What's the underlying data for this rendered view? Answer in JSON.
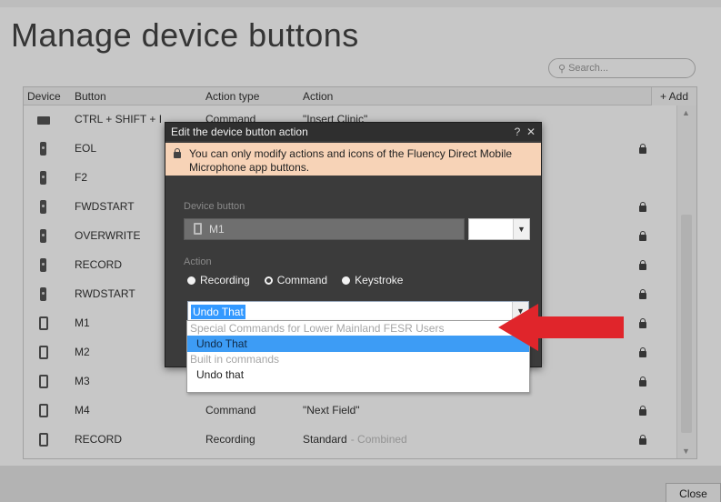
{
  "window": {
    "title": "Manage device buttons",
    "search_placeholder": "Search...",
    "close_label": "Close"
  },
  "table": {
    "headers": {
      "device": "Device",
      "button": "Button",
      "action_type": "Action type",
      "action": "Action",
      "add": "+ Add"
    },
    "rows": [
      {
        "device_icon": "keyboard-icon",
        "button": "CTRL + SHIFT + I",
        "action_type": "Command",
        "action": "\"Insert Clinic\"",
        "action_extra": "",
        "locked": false
      },
      {
        "device_icon": "microphone-icon",
        "button": "EOL",
        "action_type": "",
        "action": "",
        "action_extra": "",
        "locked": true
      },
      {
        "device_icon": "microphone-icon",
        "button": "F2",
        "action_type": "",
        "action": "",
        "action_extra": "",
        "locked": false
      },
      {
        "device_icon": "microphone-icon",
        "button": "FWDSTART",
        "action_type": "",
        "action": "",
        "action_extra": "",
        "locked": true
      },
      {
        "device_icon": "microphone-icon",
        "button": "OVERWRITE",
        "action_type": "",
        "action": "",
        "action_extra": "",
        "locked": true
      },
      {
        "device_icon": "microphone-icon",
        "button": "RECORD",
        "action_type": "",
        "action": "",
        "action_extra": "",
        "locked": true
      },
      {
        "device_icon": "microphone-icon",
        "button": "RWDSTART",
        "action_type": "",
        "action": "",
        "action_extra": "",
        "locked": true
      },
      {
        "device_icon": "phone-icon",
        "button": "M1",
        "action_type": "",
        "action": "",
        "action_extra": "",
        "locked": true
      },
      {
        "device_icon": "phone-icon",
        "button": "M2",
        "action_type": "",
        "action": "",
        "action_extra": "",
        "locked": true
      },
      {
        "device_icon": "phone-icon",
        "button": "M3",
        "action_type": "",
        "action": "",
        "action_extra": "",
        "locked": true
      },
      {
        "device_icon": "phone-icon",
        "button": "M4",
        "action_type": "Command",
        "action": "\"Next Field\"",
        "action_extra": "",
        "locked": true
      },
      {
        "device_icon": "phone-icon",
        "button": "RECORD",
        "action_type": "Recording",
        "action": "Standard",
        "action_extra": "- Combined",
        "locked": true
      }
    ]
  },
  "dialog": {
    "title": "Edit the device button action",
    "help": "?",
    "close": "✕",
    "notice": "You can only modify actions and icons of the Fluency Direct Mobile Microphone app buttons.",
    "device_button_label": "Device button",
    "device_button_value": "M1",
    "action_label": "Action",
    "radios": [
      {
        "label": "Recording",
        "checked": false
      },
      {
        "label": "Command",
        "checked": true
      },
      {
        "label": "Keystroke",
        "checked": false
      }
    ],
    "combo_value": "Undo That"
  },
  "dropdown": {
    "groups": [
      {
        "label": "Special Commands for Lower Mainland FESR Users",
        "items": [
          {
            "label": "Undo That",
            "selected": true
          }
        ]
      },
      {
        "label": "Built in commands",
        "items": [
          {
            "label": "Undo that",
            "selected": false
          }
        ]
      }
    ]
  },
  "colors": {
    "arrow": "#e0252b",
    "notice_bg": "#f7d3b7",
    "dialog_bg": "#3b3b3b",
    "selection": "#3d9cf5"
  }
}
